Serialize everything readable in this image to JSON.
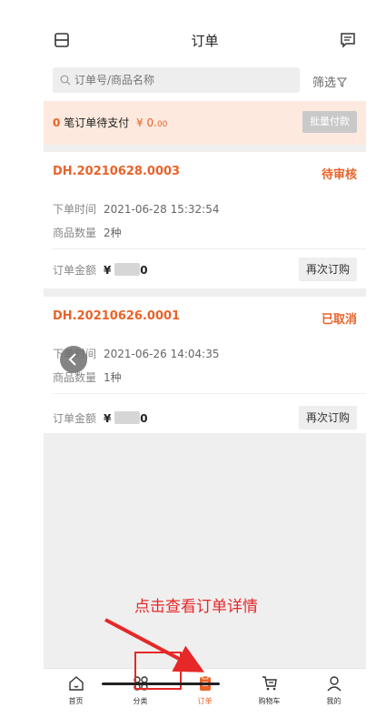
{
  "header": {
    "title": "订单",
    "left_icon": "layout-icon",
    "right_icon": "message-icon"
  },
  "search": {
    "placeholder": "订单号/商品名称",
    "filter_label": "筛选"
  },
  "pending": {
    "count": "0",
    "text": "笔订单待支付",
    "amount_main": "¥ 0.",
    "amount_small": "00",
    "batch_label": "批量付款"
  },
  "orders": [
    {
      "order_no": "DH.20210628.0003",
      "status": "待审核",
      "time_label": "下单时间",
      "time_value": "2021-06-28 15:32:54",
      "qty_label": "商品数量",
      "qty_value": "2种",
      "total_label": "订单金额",
      "total_prefix": "¥",
      "total_suffix": "0",
      "reorder_label": "再次订购"
    },
    {
      "order_no": "DH.20210626.0001",
      "status": "已取消",
      "time_label": "下单时间",
      "time_value": "2021-06-26 14:04:35",
      "qty_label": "商品数量",
      "qty_value": "1种",
      "total_label": "订单金额",
      "total_prefix": "¥",
      "total_suffix": "0",
      "reorder_label": "再次订购"
    }
  ],
  "annotation": "点击查看订单详情",
  "tabbar": [
    {
      "label": "首页",
      "icon": "home-icon"
    },
    {
      "label": "分类",
      "icon": "category-icon"
    },
    {
      "label": "订单",
      "icon": "order-icon",
      "active": true
    },
    {
      "label": "购物车",
      "icon": "cart-icon"
    },
    {
      "label": "我的",
      "icon": "user-icon"
    }
  ],
  "colors": {
    "accent": "#e8632a",
    "annotation": "#e62828",
    "pending_bg": "#fde9dd"
  }
}
